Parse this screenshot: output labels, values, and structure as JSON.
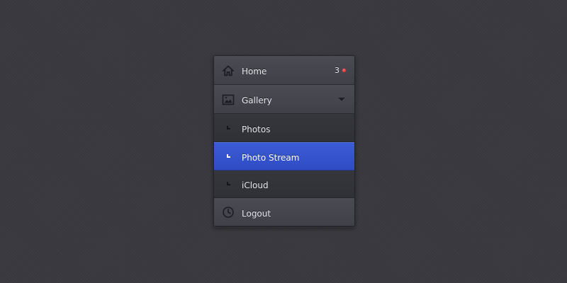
{
  "menu": {
    "home": {
      "label": "Home",
      "icon": "home-icon",
      "badge_count": "3",
      "badge_color": "#d3202a"
    },
    "gallery": {
      "label": "Gallery",
      "icon": "image-icon",
      "expand_icon": "chevron-down-icon"
    },
    "sub_items": [
      {
        "label": "Photos",
        "icon": "sub-item-icon",
        "active": false
      },
      {
        "label": "Photo Stream",
        "icon": "sub-item-icon",
        "active": true
      },
      {
        "label": "iCloud",
        "icon": "sub-item-icon",
        "active": false
      }
    ],
    "logout": {
      "label": "Logout",
      "icon": "clock-icon"
    }
  },
  "colors": {
    "background": "#39393f",
    "active_item": "#3b5bd6",
    "badge_dot": "#d3202a"
  }
}
